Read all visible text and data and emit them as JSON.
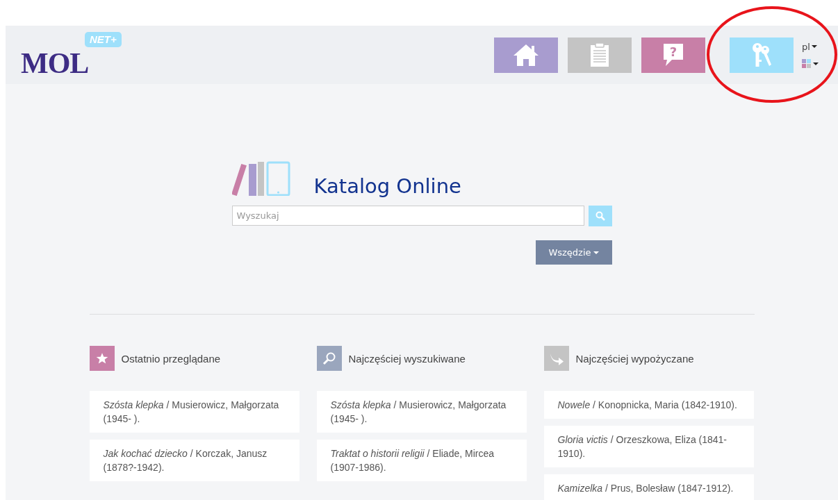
{
  "logo": {
    "text": "MOL",
    "badge": "NET+"
  },
  "nav": [
    {
      "kind": "home",
      "color": "#a89ccf"
    },
    {
      "kind": "clipboard",
      "color": "#c4c4c4"
    },
    {
      "kind": "help",
      "color": "#c87fa7",
      "symbol": "?"
    },
    {
      "kind": "keys",
      "color": "#9ee0fb"
    }
  ],
  "language": "pl",
  "annotation": {
    "kind": "ellipse"
  },
  "catalog": {
    "title": "Katalog Online",
    "search": {
      "placeholder": "Wyszukaj"
    },
    "scope": "Wszędzie"
  },
  "sections": [
    {
      "kind": "star",
      "color": "#c87fa7",
      "title": "Ostatnio przeglądane",
      "items": [
        "*Szósta klepka* / Musierowicz, Małgorzata (1945- ).",
        "*Jak kochać dziecko* / Korczak, Janusz (1878?-1942)."
      ]
    },
    {
      "kind": "search",
      "color": "#9aa6bd",
      "title": "Najczęściej wyszukiwane",
      "items": [
        "*Szósta klepka* / Musierowicz, Małgorzata (1945- ).",
        "*Traktat o historii religii* / Eliade, Mircea (1907-1986)."
      ]
    },
    {
      "kind": "share",
      "color": "#c4c4c4",
      "title": "Najczęściej wypożyczane",
      "items": [
        "*Nowele* / Konopnicka, Maria (1842-1910).",
        "*Gloria victis* / Orzeszkowa, Eliza (1841-1910).",
        "*Kamizelka* / Prus, Bolesław (1847-1912)."
      ]
    }
  ]
}
